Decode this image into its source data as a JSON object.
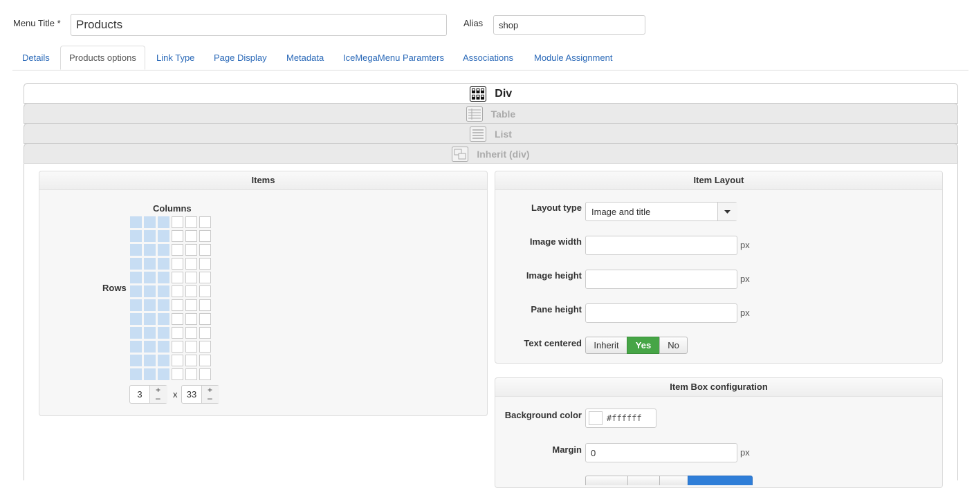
{
  "form": {
    "menu_title_label": "Menu Title *",
    "menu_title_value": "Products",
    "alias_label": "Alias",
    "alias_value": "shop"
  },
  "tabs": [
    {
      "label": "Details"
    },
    {
      "label": "Products options",
      "active": true
    },
    {
      "label": "Link Type"
    },
    {
      "label": "Page Display"
    },
    {
      "label": "Metadata"
    },
    {
      "label": "IceMegaMenu Paramters"
    },
    {
      "label": "Associations"
    },
    {
      "label": "Module Assignment"
    }
  ],
  "accordion": [
    {
      "label": "Div",
      "icon": "div-grid-icon",
      "active": true
    },
    {
      "label": "Table",
      "icon": "table-icon"
    },
    {
      "label": "List",
      "icon": "list-icon"
    },
    {
      "label": "Inherit (div)",
      "icon": "inherit-icon"
    }
  ],
  "items_panel": {
    "title": "Items",
    "columns_label": "Columns",
    "rows_label": "Rows",
    "grid": {
      "selected_columns": 3,
      "total_columns": 6,
      "visible_rows": 12
    },
    "columns_value": "3",
    "times": "x",
    "rows_value": "33",
    "plus": "+",
    "minus": "–"
  },
  "item_layout": {
    "title": "Item Layout",
    "layout_type_label": "Layout type",
    "layout_type_value": "Image and title",
    "image_width_label": "Image width",
    "image_width_value": "",
    "image_height_label": "Image height",
    "image_height_value": "",
    "pane_height_label": "Pane height",
    "pane_height_value": "",
    "unit": "px",
    "text_centered_label": "Text centered",
    "text_centered_options": [
      "Inherit",
      "Yes",
      "No"
    ],
    "text_centered_selected": "Yes"
  },
  "item_box": {
    "title": "Item Box configuration",
    "bg_color_label": "Background color",
    "bg_color_value": "#ffffff",
    "margin_label": "Margin",
    "margin_value": "0",
    "unit": "px"
  },
  "colors": {
    "link": "#2a69b8",
    "grid_selected": "#c7ddf3",
    "yes_active": "#46a546",
    "blue_btn": "#2f7ed8"
  }
}
